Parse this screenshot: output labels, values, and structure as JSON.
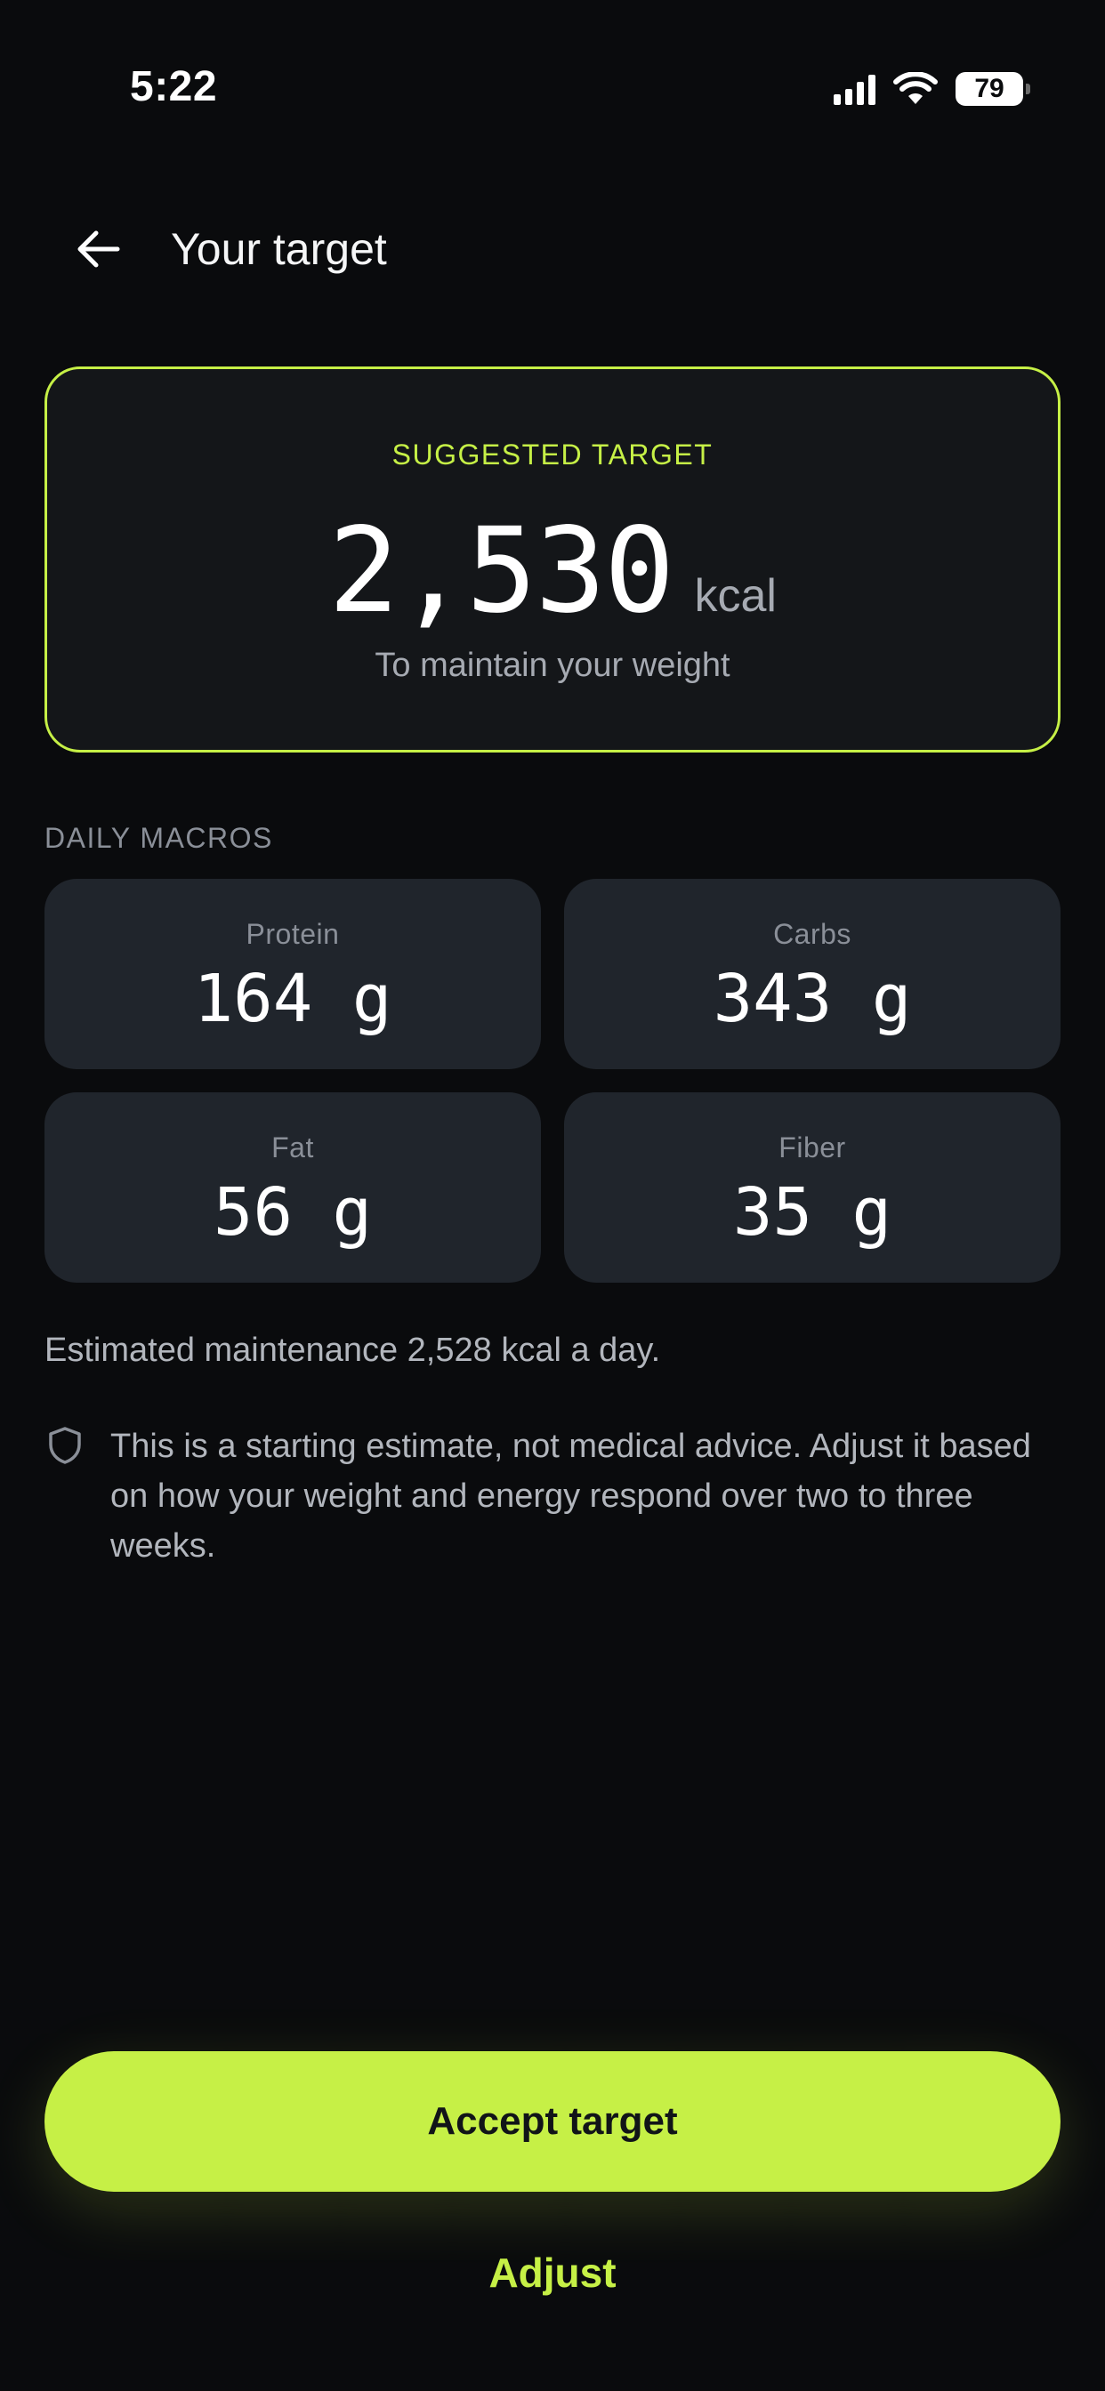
{
  "status_bar": {
    "time": "5:22",
    "battery": "79"
  },
  "header": {
    "title": "Your target"
  },
  "target": {
    "label": "SUGGESTED TARGET",
    "value": "2,530",
    "unit": "kcal",
    "subtitle": "To maintain your weight"
  },
  "macros": {
    "section_label": "DAILY MACROS",
    "items": [
      {
        "name": "Protein",
        "value": "164 g"
      },
      {
        "name": "Carbs",
        "value": "343 g"
      },
      {
        "name": "Fat",
        "value": "56 g"
      },
      {
        "name": "Fiber",
        "value": "35 g"
      }
    ]
  },
  "maintenance_text": "Estimated maintenance 2,528 kcal a day.",
  "disclaimer_text": "This is a starting estimate, not medical advice. Adjust it based on how your weight and energy respond over two to three weeks.",
  "actions": {
    "accept_label": "Accept target",
    "adjust_label": "Adjust"
  },
  "colors": {
    "accent": "#c6f046",
    "background": "#0a0b0d",
    "card": "#20252c"
  },
  "icons": {
    "back": "arrow-left-icon",
    "disclaimer": "shield-icon",
    "wifi": "wifi-icon",
    "signal": "cellular-signal-icon",
    "battery": "battery-icon"
  }
}
